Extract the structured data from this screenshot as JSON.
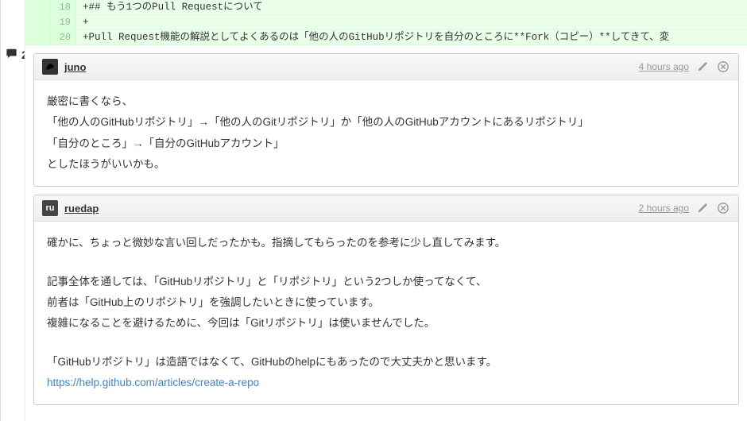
{
  "gutter": {
    "comment_count": "2"
  },
  "diff": {
    "rows": [
      {
        "ln1": "",
        "ln2": "18",
        "code": "+## もう1つのPull Requestについて"
      },
      {
        "ln1": "",
        "ln2": "19",
        "code": "+"
      },
      {
        "ln1": "",
        "ln2": "20",
        "code": "+Pull Request機能の解説としてよくあるのは「他の人のGitHubリポジトリを自分のところに**Fork（コピー）**してきて、変"
      }
    ]
  },
  "comments": [
    {
      "author": "juno",
      "avatar_kind": "horse",
      "avatar_glyph": "🐴",
      "timestamp": "4 hours ago",
      "body_lines": [
        "厳密に書くなら、",
        "「他の人のGitHubリポジトリ」→「他の人のGitリポジトリ」か「他の人のGitHubアカウントにあるリポジトリ」",
        "「自分のところ」→「自分のGitHubアカウント」",
        "としたほうがいいかも。"
      ]
    },
    {
      "author": "ruedap",
      "avatar_kind": "ru",
      "avatar_glyph": "ru",
      "timestamp": "2 hours ago",
      "body_lines_block1": [
        "確かに、ちょっと微妙な言い回しだったかも。指摘してもらったのを参考に少し直してみます。"
      ],
      "body_lines_block2": [
        "記事全体を通しては、「GitHubリポジトリ」と「リポジトリ」という2つしか使ってなくて、",
        "前者は「GitHub上のリポジトリ」を強調したいときに使っています。",
        "複雑になることを避けるために、今回は「Gitリポジトリ」は使いませんでした。"
      ],
      "body_lines_block3": [
        "「GitHubリポジトリ」は造語ではなくて、GitHubのhelpにもあったので大丈夫かと思います。"
      ],
      "link_text": "https://help.github.com/articles/create-a-repo",
      "link_href": "https://help.github.com/articles/create-a-repo"
    }
  ]
}
